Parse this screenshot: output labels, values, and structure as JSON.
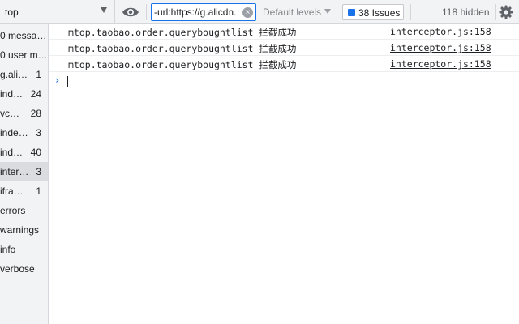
{
  "toolbar": {
    "context": "top",
    "filter_value": "-url:https://g.alicdn.",
    "levels": "Default levels",
    "issues": "38 Issues",
    "hidden": "118 hidden"
  },
  "sidebar": {
    "items": [
      {
        "label": "0 messa…",
        "count": ""
      },
      {
        "label": "0 user m…",
        "count": ""
      },
      {
        "label": "g.ali…",
        "count": "1"
      },
      {
        "label": "ind…",
        "count": "24"
      },
      {
        "label": "vc…",
        "count": "28"
      },
      {
        "label": "inde…",
        "count": "3"
      },
      {
        "label": "ind…",
        "count": "40"
      },
      {
        "label": "inter…",
        "count": "3",
        "selected": true
      },
      {
        "label": "ifra…",
        "count": "1"
      },
      {
        "label": "errors",
        "count": ""
      },
      {
        "label": "warnings",
        "count": ""
      },
      {
        "label": "info",
        "count": ""
      },
      {
        "label": "verbose",
        "count": ""
      }
    ]
  },
  "console": {
    "messages": [
      {
        "text": "mtop.taobao.order.queryboughtlist 拦截成功",
        "source": "interceptor.js:158"
      },
      {
        "text": "mtop.taobao.order.queryboughtlist 拦截成功",
        "source": "interceptor.js:158"
      },
      {
        "text": "mtop.taobao.order.queryboughtlist 拦截成功",
        "source": "interceptor.js:158"
      }
    ],
    "prompt": "›"
  },
  "colors": {
    "accent": "#1a73e8",
    "toolbar_bg": "#f1f3f4",
    "selected_bg": "#dadce0"
  },
  "icons": {
    "eye": "eye-icon",
    "clear": "clear-icon",
    "issue": "issue-icon",
    "settings": "gear-icon"
  }
}
